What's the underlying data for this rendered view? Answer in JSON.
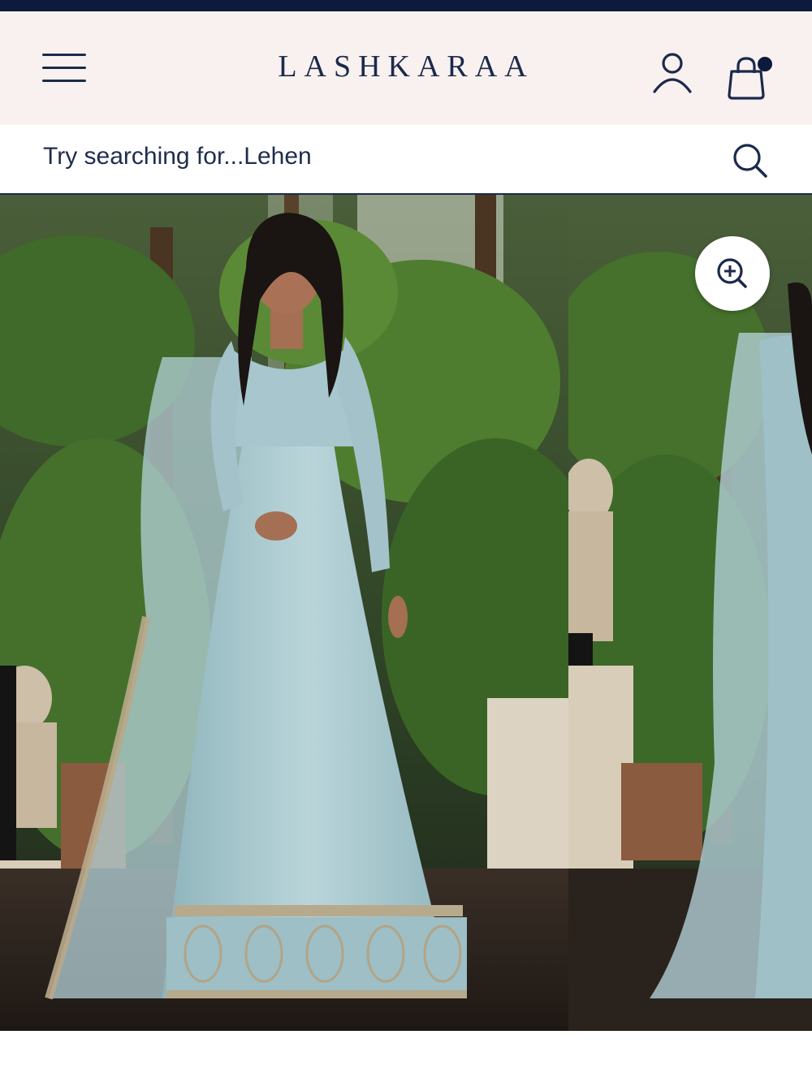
{
  "header": {
    "brand": "LASHKARAA",
    "menu_icon": "hamburger-menu-icon",
    "account_icon": "user-icon",
    "bag_icon": "shopping-bag-icon",
    "bag_has_items": true
  },
  "search": {
    "placeholder": "Try searching for...Lehen",
    "icon": "search-icon"
  },
  "gallery": {
    "images": [
      {
        "subject": "model in pale blue anarkali with embroidered dupatta, garden conservatory backdrop"
      },
      {
        "subject": "partial view of same outfit, next image in carousel"
      }
    ],
    "zoom_icon": "zoom-in-icon"
  },
  "colors": {
    "navy": "#1b2a4c",
    "header_bg": "#f9f1ef",
    "top_strip": "#0c1a3c",
    "outfit_blue": "#a9c8cf"
  }
}
